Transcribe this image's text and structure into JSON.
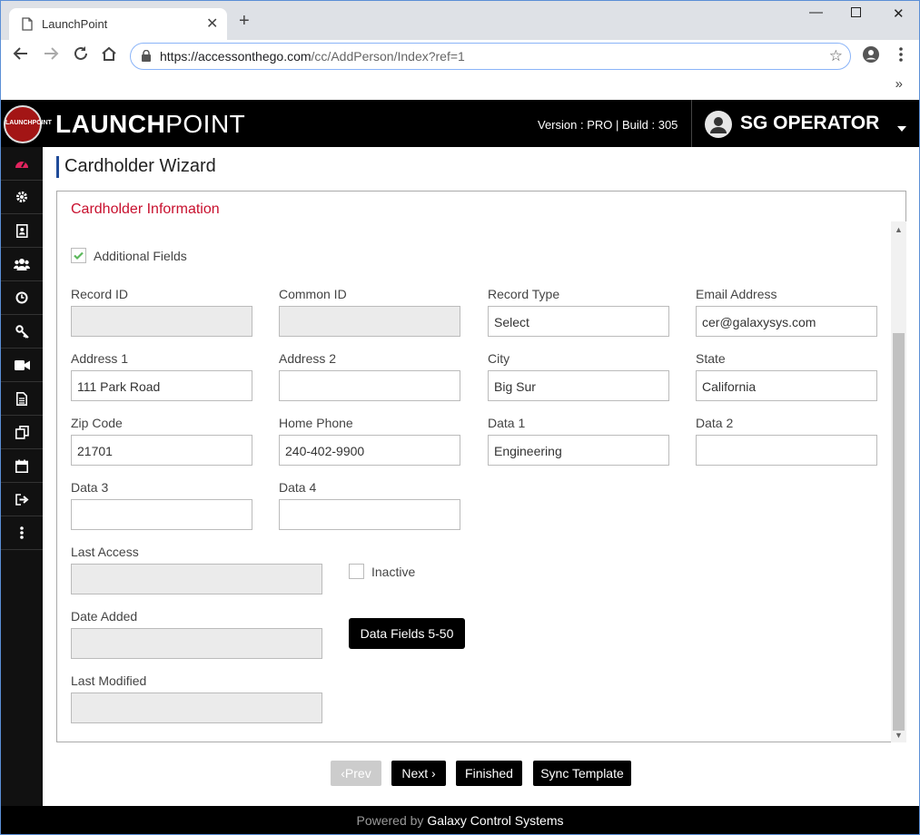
{
  "browser": {
    "tab_title": "LaunchPoint",
    "new_tab": "+",
    "url_host": "https://accessonthego.com",
    "url_path": "/cc/AddPerson/Index?ref=1",
    "bookmarks_more": "»"
  },
  "app": {
    "brand_bold": "LAUNCH",
    "brand_light": "POINT",
    "logo_text": "LAUNCHPOINT",
    "version_label": "Version : ",
    "version_value": "PRO",
    "build_label": " | Build : ",
    "build_value": "305",
    "user_name": "SG OPERATOR"
  },
  "sidebar": {
    "items": [
      "dashboard-icon",
      "gear-icon",
      "contact-card-icon",
      "users-icon",
      "clock-icon",
      "key-icon",
      "video-icon",
      "document-icon",
      "copy-icon",
      "calendar-icon",
      "exit-icon",
      "more-vertical-icon"
    ]
  },
  "page": {
    "title": "Cardholder Wizard",
    "panel_title": "Cardholder Information",
    "additional_fields_label": "Additional Fields",
    "additional_fields_checked": true
  },
  "fields": {
    "record_id": {
      "label": "Record ID",
      "value": ""
    },
    "common_id": {
      "label": "Common ID",
      "value": ""
    },
    "record_type": {
      "label": "Record Type",
      "value": "Select"
    },
    "email": {
      "label": "Email Address",
      "value": "cer@galaxysys.com"
    },
    "address1": {
      "label": "Address 1",
      "value": "111 Park Road"
    },
    "address2": {
      "label": "Address 2",
      "value": ""
    },
    "city": {
      "label": "City",
      "value": "Big Sur"
    },
    "state": {
      "label": "State",
      "value": "California"
    },
    "zip": {
      "label": "Zip Code",
      "value": "21701"
    },
    "home_phone": {
      "label": "Home Phone",
      "value": "240-402-9900"
    },
    "data1": {
      "label": "Data 1",
      "value": "Engineering"
    },
    "data2": {
      "label": "Data 2",
      "value": ""
    },
    "data3": {
      "label": "Data 3",
      "value": ""
    },
    "data4": {
      "label": "Data 4",
      "value": ""
    },
    "last_access": {
      "label": "Last Access",
      "value": ""
    },
    "date_added": {
      "label": "Date Added",
      "value": ""
    },
    "last_modified": {
      "label": "Last Modified",
      "value": ""
    },
    "inactive_label": "Inactive"
  },
  "buttons": {
    "data_fields": "Data Fields 5-50",
    "prev": "‹Prev",
    "next": "Next ›",
    "finished": "Finished",
    "sync_template": "Sync Template"
  },
  "footer": {
    "prefix": "Powered by ",
    "company": "Galaxy Control Systems"
  },
  "colors": {
    "accent_red": "#c8102e",
    "title_bar_blue": "#1f4b99",
    "header_bg": "#000000"
  }
}
